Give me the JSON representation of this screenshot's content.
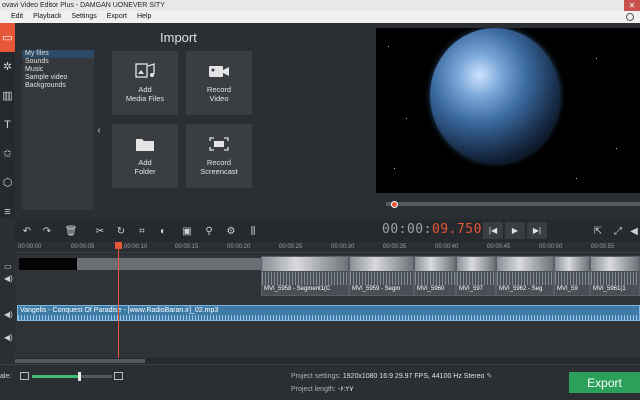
{
  "window": {
    "title": "ovavi Video Editor Plus - DAMGAN UONEVER SITY",
    "close_glyph": "✕"
  },
  "menu": [
    "Edit",
    "Playback",
    "Settings",
    "Export",
    "Help"
  ],
  "import_panel": {
    "title": "Import",
    "library": [
      "My files",
      "Sounds",
      "Music",
      "Sample video",
      "Backgrounds"
    ],
    "tiles": [
      {
        "label_line1": "Add",
        "label_line2": "Media Files",
        "icon": "add-media-icon"
      },
      {
        "label_line1": "Record",
        "label_line2": "Video",
        "icon": "camera-icon"
      },
      {
        "label_line1": "Add",
        "label_line2": "Folder",
        "icon": "folder-icon"
      },
      {
        "label_line1": "Record",
        "label_line2": "Screencast",
        "icon": "screencast-icon"
      }
    ]
  },
  "player": {
    "timecode_prefix": "00:00:",
    "timecode_suffix": "09.750"
  },
  "ruler": [
    "00:00:00",
    "00:00:05",
    "00:00:10",
    "00:00:15",
    "00:00:20",
    "00:00:25",
    "00:00:30",
    "00:00:35",
    "00:00:40",
    "00:00:45",
    "00:00:50",
    "00:00:55"
  ],
  "timeline": {
    "video_clips": [
      "MVI_5958 - Segment1(C",
      "MVI_5959 - Segm",
      "MVI_5960",
      "MVI_597",
      "MVI_5962 - Seg",
      "MVI_59",
      "MVI_5961(1"
    ],
    "audio_clip": "Vangelis - Conquest Of Paradise - [www.RadioBaran.ir]_02.mp3"
  },
  "status": {
    "scale_label": "ale:",
    "scale_value": 0.59,
    "project_settings_label": "Project settings:",
    "project_settings_value": "1920x1080 16:9 29.97 FPS, 44100 Hz Stereo",
    "project_length_label": "Project length:",
    "project_length_value": "-۶:۲۷",
    "export_label": "Export"
  },
  "colors": {
    "accent": "#e8563a",
    "export": "#2aa05a",
    "audio": "#3e7aa6"
  }
}
